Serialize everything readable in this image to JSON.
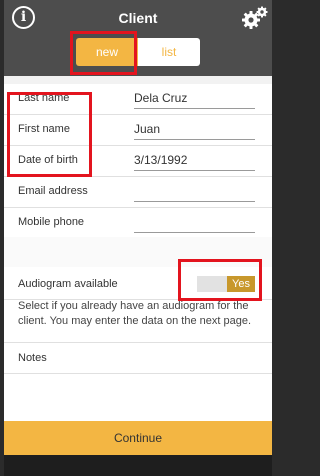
{
  "header": {
    "title": "Client",
    "info_icon": "info-icon",
    "settings_icon": "gears-icon"
  },
  "tabs": {
    "new": "new",
    "list": "list",
    "selected": "new"
  },
  "form": {
    "last_name": {
      "label": "Last name",
      "value": "Dela Cruz"
    },
    "first_name": {
      "label": "First name",
      "value": "Juan"
    },
    "dob": {
      "label": "Date of birth",
      "value": "3/13/1992"
    },
    "email": {
      "label": "Email address",
      "value": ""
    },
    "mobile": {
      "label": "Mobile phone",
      "value": ""
    }
  },
  "audiogram": {
    "label": "Audiogram available",
    "toggle_value": "Yes",
    "helper": "Select if you already have an audiogram for the client. You may enter the data on the next page."
  },
  "notes": {
    "label": "Notes"
  },
  "continue_label": "Continue",
  "colors": {
    "header_bg": "#4d4d4d",
    "accent": "#f3b643",
    "highlight": "#e3141e"
  }
}
